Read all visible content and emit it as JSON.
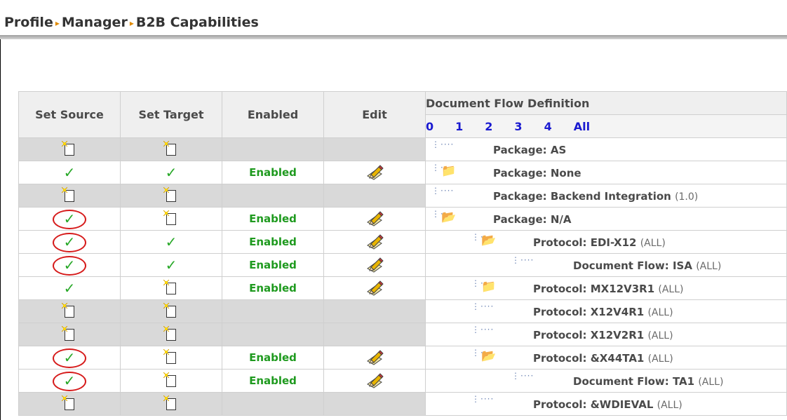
{
  "breadcrumb": [
    "Profile",
    "Manager",
    "B2B Capabilities"
  ],
  "table": {
    "headers": {
      "set_source": "Set Source",
      "set_target": "Set Target",
      "enabled": "Enabled",
      "edit": "Edit",
      "flow_title": "Document Flow Definition"
    },
    "levels": [
      "0",
      "1",
      "2",
      "3",
      "4",
      "All"
    ],
    "rows": [
      {
        "gray": true,
        "source": "new",
        "source_circled": false,
        "target": "new",
        "enabled": "",
        "edit": false,
        "flow_icon": "dots",
        "indent": 0,
        "flow_label": "Package: AS",
        "flow_suffix": ""
      },
      {
        "gray": false,
        "source": "check",
        "source_circled": false,
        "target": "check",
        "enabled": "Enabled",
        "edit": true,
        "flow_icon": "closed",
        "indent": 0,
        "flow_label": "Package: None",
        "flow_suffix": ""
      },
      {
        "gray": true,
        "source": "new",
        "source_circled": false,
        "target": "new",
        "enabled": "",
        "edit": false,
        "flow_icon": "dots",
        "indent": 0,
        "flow_label": "Package: Backend Integration",
        "flow_suffix": "(1.0)"
      },
      {
        "gray": false,
        "source": "check",
        "source_circled": true,
        "target": "new",
        "enabled": "Enabled",
        "edit": true,
        "flow_icon": "open",
        "indent": 0,
        "flow_label": "Package: N/A",
        "flow_suffix": ""
      },
      {
        "gray": false,
        "source": "check",
        "source_circled": true,
        "target": "check",
        "enabled": "Enabled",
        "edit": true,
        "flow_icon": "open",
        "indent": 1,
        "flow_label": "Protocol: EDI-X12",
        "flow_suffix": "(ALL)"
      },
      {
        "gray": false,
        "source": "check",
        "source_circled": true,
        "target": "check",
        "enabled": "Enabled",
        "edit": true,
        "flow_icon": "dots",
        "indent": 2,
        "flow_label": "Document Flow: ISA",
        "flow_suffix": "(ALL)"
      },
      {
        "gray": false,
        "source": "check",
        "source_circled": false,
        "target": "new",
        "enabled": "Enabled",
        "edit": true,
        "flow_icon": "closed",
        "indent": 1,
        "flow_label": "Protocol: MX12V3R1",
        "flow_suffix": "(ALL)"
      },
      {
        "gray": true,
        "source": "new",
        "source_circled": false,
        "target": "new",
        "enabled": "",
        "edit": false,
        "flow_icon": "dots",
        "indent": 1,
        "flow_label": "Protocol: X12V4R1",
        "flow_suffix": "(ALL)"
      },
      {
        "gray": true,
        "source": "new",
        "source_circled": false,
        "target": "new",
        "enabled": "",
        "edit": false,
        "flow_icon": "dots",
        "indent": 1,
        "flow_label": "Protocol: X12V2R1",
        "flow_suffix": "(ALL)"
      },
      {
        "gray": false,
        "source": "check",
        "source_circled": true,
        "target": "new",
        "enabled": "Enabled",
        "edit": true,
        "flow_icon": "open",
        "indent": 1,
        "flow_label": "Protocol: &X44TA1",
        "flow_suffix": "(ALL)"
      },
      {
        "gray": false,
        "source": "check",
        "source_circled": true,
        "target": "new",
        "enabled": "Enabled",
        "edit": true,
        "flow_icon": "dots",
        "indent": 2,
        "flow_label": "Document Flow: TA1",
        "flow_suffix": "(ALL)"
      },
      {
        "gray": true,
        "source": "new",
        "source_circled": false,
        "target": "new",
        "enabled": "",
        "edit": false,
        "flow_icon": "dots",
        "indent": 1,
        "flow_label": "Protocol: &WDIEVAL",
        "flow_suffix": "(ALL)"
      }
    ]
  }
}
